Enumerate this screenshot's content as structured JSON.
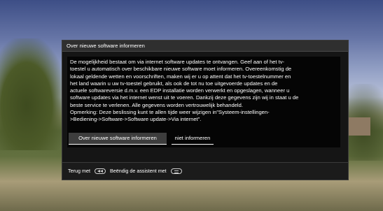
{
  "dialog": {
    "title": "Over nieuwe software informeren",
    "body": "De mogelijkheid bestaat om via internet software updates te ontvangen. Geef aan of het tv-\ntoestel u automatisch over beschikbare nieuwe software moet informeren. Overeenkomstig de\nlokaal geldende wetten en voorschriften, maken wij er u op attent dat het tv-toestelnummer en\nhet land waarin u uw tv-toestel gebruikt, als ook de tot nu toe uitgevoerde updates en de\nactuele softwareversie d.m.v. een EDP installatie worden verwerkt en opgeslagen, wanneer u\nsoftware updates via het internet wenst uit te voeren. Dankzij deze gegevens zijn wij in staat u  de\nbeste service te verlenen. Alle gegevens worden vertrouwelijk behandeld.\nOpmerking: Deze beslissing kunt te allen tijde weer wijzigen in\"Systeem-instellingen-\n>Bediening->Software->Software update->Via internet\".",
    "primary_button": "Over nieuwe software informeren",
    "secondary_button": "niet informeren"
  },
  "footer": {
    "back_label": "Terug met",
    "back_icon": "back-key-icon",
    "end_label": "Beëndig de assistent met",
    "end_icon": "end-key-icon"
  }
}
